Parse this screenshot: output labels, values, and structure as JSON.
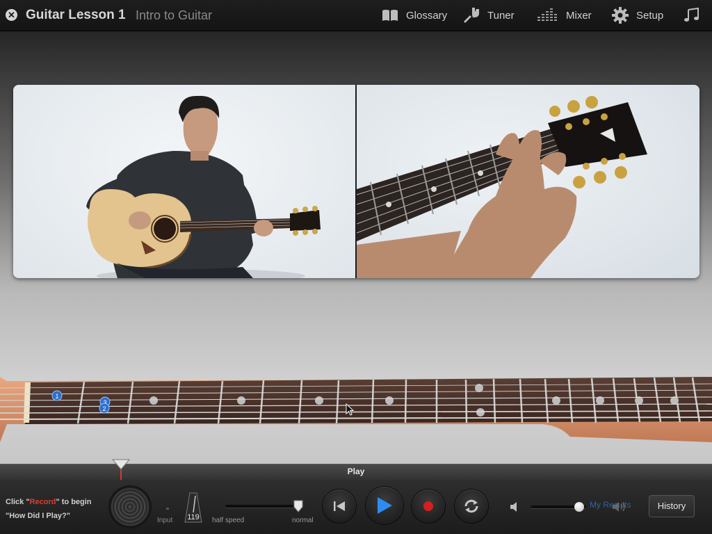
{
  "titlebar": {
    "title": "Guitar Lesson 1",
    "subtitle": "Intro to Guitar",
    "nav": [
      {
        "label": "Glossary",
        "icon": "book-icon"
      },
      {
        "label": "Tuner",
        "icon": "tuning-fork-icon"
      },
      {
        "label": "Mixer",
        "icon": "mixer-icon"
      },
      {
        "label": "Setup",
        "icon": "gear-icon"
      },
      {
        "label": "",
        "icon": "music-note-icon"
      }
    ]
  },
  "fretboard": {
    "finger_markers": [
      "1",
      "3",
      "2"
    ]
  },
  "timeline": {
    "label": "Play"
  },
  "controls": {
    "hint_prefix": "Click \"",
    "hint_highlight": "Record",
    "hint_suffix": "\" to begin",
    "hint_line2": "\"How Did I Play?\"",
    "input_label": "Input",
    "tempo": "119",
    "speed_min_label": "half speed",
    "speed_max_label": "normal",
    "speed_level": 1.0,
    "volume_level": 0.88,
    "my_results_label": "My Results",
    "history_label": "History"
  },
  "colors": {
    "accent_blue": "#2d8cf0",
    "record_red": "#d42020",
    "highlight_red": "#e23b2e"
  }
}
